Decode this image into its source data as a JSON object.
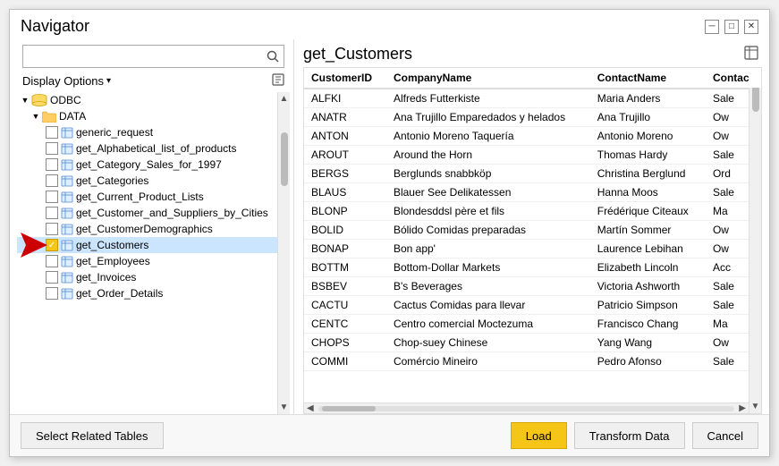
{
  "dialog": {
    "title": "Navigator",
    "title_bar_controls": {
      "minimize": "─",
      "maximize": "□",
      "close": "✕"
    }
  },
  "left_panel": {
    "search_placeholder": "",
    "display_options_label": "Display Options",
    "display_options_arrow": "▾",
    "tree": {
      "odbc_label": "ODBC",
      "data_label": "DATA",
      "items": [
        {
          "label": "generic_request",
          "checked": false,
          "selected": false
        },
        {
          "label": "get_Alphabetical_list_of_products",
          "checked": false,
          "selected": false
        },
        {
          "label": "get_Category_Sales_for_1997",
          "checked": false,
          "selected": false
        },
        {
          "label": "get_Categories",
          "checked": false,
          "selected": false
        },
        {
          "label": "get_Current_Product_Lists",
          "checked": false,
          "selected": false
        },
        {
          "label": "get_Customer_and_Suppliers_by_Cities",
          "checked": false,
          "selected": false
        },
        {
          "label": "get_CustomerDemographics",
          "checked": false,
          "selected": false
        },
        {
          "label": "get_Customers",
          "checked": true,
          "selected": true
        },
        {
          "label": "get_Employees",
          "checked": false,
          "selected": false
        },
        {
          "label": "get_Invoices",
          "checked": false,
          "selected": false
        },
        {
          "label": "get_Order_Details",
          "checked": false,
          "selected": false
        }
      ]
    }
  },
  "right_panel": {
    "title": "get_Customers",
    "columns": [
      "CustomerID",
      "CompanyName",
      "ContactName",
      "Contac"
    ],
    "rows": [
      [
        "ALFKI",
        "Alfreds Futterkiste",
        "Maria Anders",
        "Sale"
      ],
      [
        "ANATR",
        "Ana Trujillo Emparedados y helados",
        "Ana Trujillo",
        "Ow"
      ],
      [
        "ANTON",
        "Antonio Moreno Taquería",
        "Antonio Moreno",
        "Ow"
      ],
      [
        "AROUT",
        "Around the Horn",
        "Thomas Hardy",
        "Sale"
      ],
      [
        "BERGS",
        "Berglunds snabbköp",
        "Christina Berglund",
        "Ord"
      ],
      [
        "BLAUS",
        "Blauer See Delikatessen",
        "Hanna Moos",
        "Sale"
      ],
      [
        "BLONP",
        "Blondesddsl père et fils",
        "Frédérique Citeaux",
        "Ma"
      ],
      [
        "BOLID",
        "Bólido Comidas preparadas",
        "Martín Sommer",
        "Ow"
      ],
      [
        "BONAP",
        "Bon app'",
        "Laurence Lebihan",
        "Ow"
      ],
      [
        "BOTTM",
        "Bottom-Dollar Markets",
        "Elizabeth Lincoln",
        "Acc"
      ],
      [
        "BSBEV",
        "B's Beverages",
        "Victoria Ashworth",
        "Sale"
      ],
      [
        "CACTU",
        "Cactus Comidas para llevar",
        "Patricio Simpson",
        "Sale"
      ],
      [
        "CENTC",
        "Centro comercial Moctezuma",
        "Francisco Chang",
        "Ma"
      ],
      [
        "CHOPS",
        "Chop-suey Chinese",
        "Yang Wang",
        "Ow"
      ],
      [
        "COMMI",
        "Comércio Mineiro",
        "Pedro Afonso",
        "Sale"
      ]
    ]
  },
  "bottom_bar": {
    "select_related_tables": "Select Related Tables",
    "load": "Load",
    "transform_data": "Transform Data",
    "cancel": "Cancel"
  }
}
